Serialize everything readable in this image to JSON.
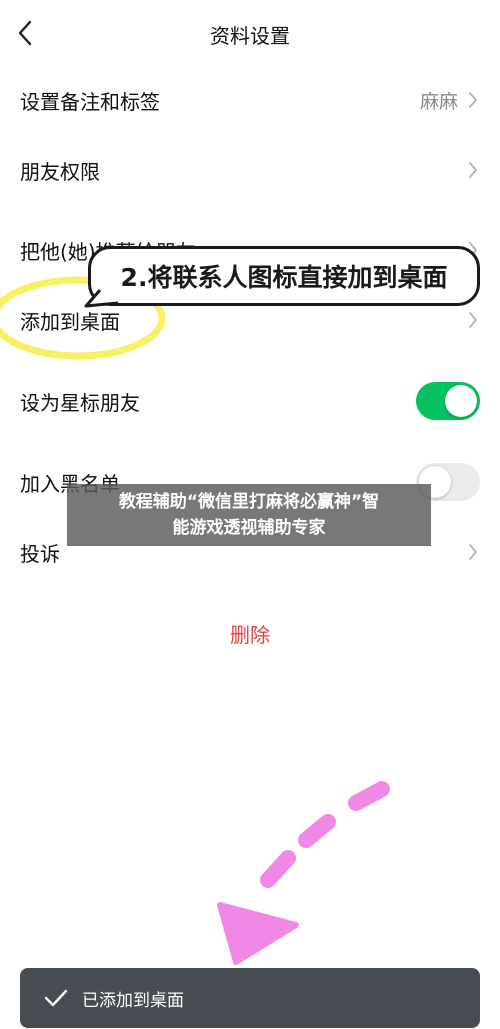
{
  "header": {
    "title": "资料设置"
  },
  "rows": [
    {
      "label": "设置备注和标签",
      "value": "麻麻"
    },
    {
      "label": "朋友权限"
    },
    {
      "label": "把他(她)推荐给朋友"
    },
    {
      "label": "添加到桌面"
    },
    {
      "label": "设为星标朋友",
      "toggle": "on"
    },
    {
      "label": "加入黑名单",
      "toggle": "off"
    },
    {
      "label": "投诉"
    }
  ],
  "delete_label": "删除",
  "annotation": {
    "bubble_text": "2.将联系人图标直接加到桌面"
  },
  "overlay": {
    "line1": "教程辅助“微信里打麻将必赢神”智",
    "line2": "能游戏透视辅助专家"
  },
  "toast": {
    "text": "已添加到桌面"
  },
  "colors": {
    "accent_green": "#07c160",
    "delete_red": "#e64340",
    "highlight_yellow": "#f5ee4a",
    "arrow_pink": "#f07ce4"
  }
}
